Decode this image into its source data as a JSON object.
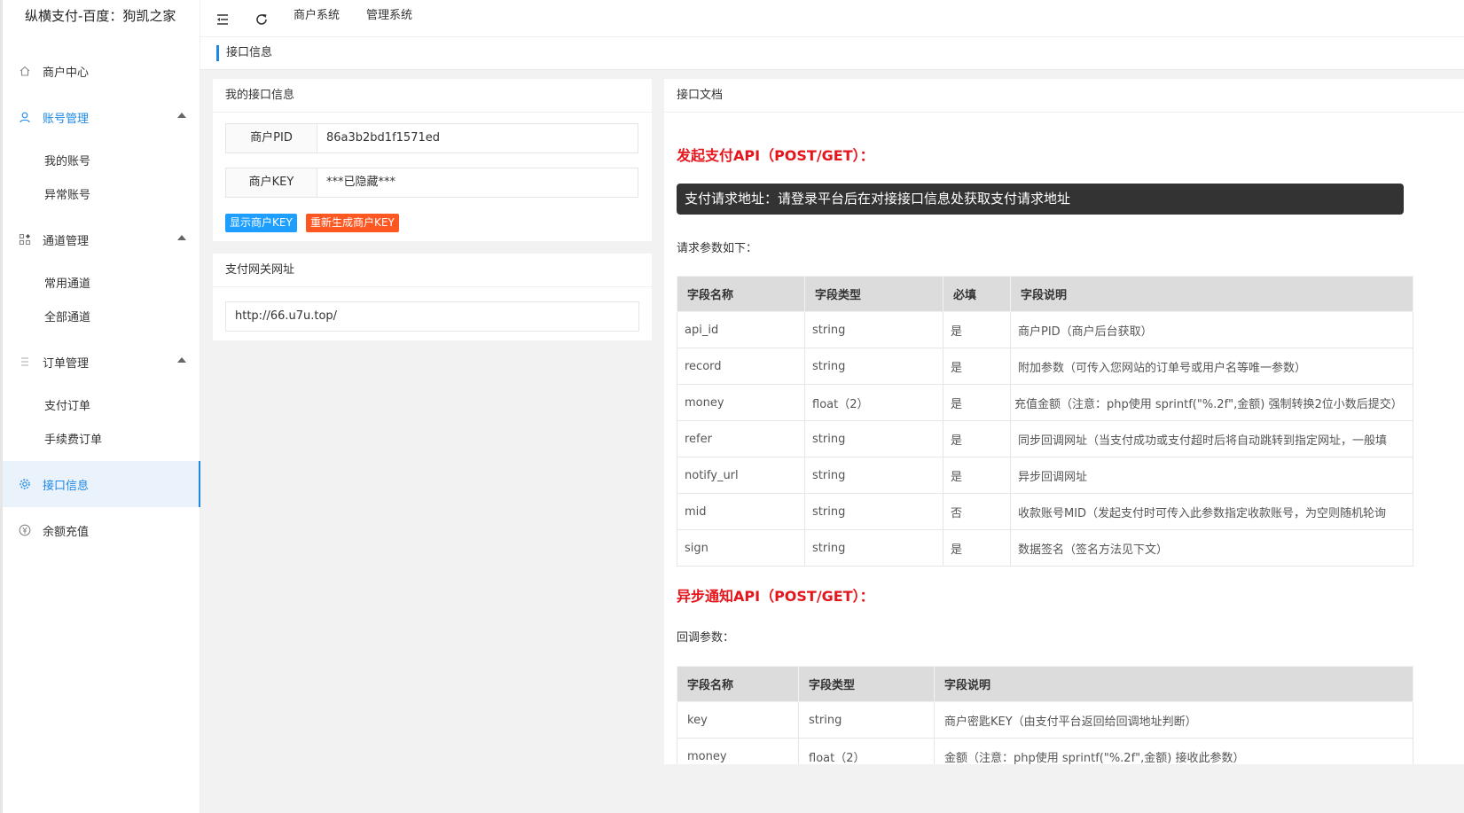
{
  "app": {
    "title": "纵横支付-百度：狗凯之家"
  },
  "topbar": {
    "menu_icon": "menu-fold-icon",
    "refresh_icon": "refresh-icon",
    "links": [
      "商户系统",
      "管理系统"
    ]
  },
  "tabbar": {
    "current": "接口信息"
  },
  "sidebar": {
    "items": [
      {
        "label": "商户中心",
        "icon": "home-icon"
      },
      {
        "label": "账号管理",
        "icon": "user-icon",
        "children": [
          "我的账号",
          "异常账号"
        ]
      },
      {
        "label": "通道管理",
        "icon": "apps-icon",
        "children": [
          "常用通道",
          "全部通道"
        ]
      },
      {
        "label": "订单管理",
        "icon": "list-icon",
        "children": [
          "支付订单",
          "手续费订单"
        ]
      },
      {
        "label": "接口信息",
        "icon": "gear-icon"
      },
      {
        "label": "余额充值",
        "icon": "yen-icon"
      }
    ]
  },
  "my_api": {
    "title": "我的接口信息",
    "pid_label": "商户PID",
    "pid_value": "86a3b2bd1f1571ed",
    "key_label": "商户KEY",
    "key_value": "***已隐藏***",
    "show_key_button": "显示商户KEY",
    "regen_key_button": "重新生成商户KEY"
  },
  "gateway": {
    "title": "支付网关网址",
    "url": "http://66.u7u.top/"
  },
  "doc": {
    "title": "接口文档",
    "pay_title": "发起支付API（POST/GET）：",
    "pay_url_note": "支付请求地址：请登录平台后在对接接口信息处获取支付请求地址",
    "request_params_label": "请求参数如下：",
    "request_table": {
      "headers": [
        "字段名称",
        "字段类型",
        "必填",
        "字段说明"
      ],
      "rows": [
        [
          "api_id",
          "string",
          "是",
          "商户PID（商户后台获取）"
        ],
        [
          "record",
          "string",
          "是",
          "附加参数（可传入您网站的订单号或用户名等唯一参数）"
        ],
        [
          "money",
          "float（2）",
          "是",
          "充值金额（注意：php使用 sprintf(\"%.2f\",金额) 强制转换2位小数后提交）"
        ],
        [
          "refer",
          "string",
          "是",
          "同步回调网址（当支付成功或支付超时后将自动跳转到指定网址，一般填"
        ],
        [
          "notify_url",
          "string",
          "是",
          "异步回调网址"
        ],
        [
          "mid",
          "string",
          "否",
          "收款账号MID（发起支付时可传入此参数指定收款账号，为空则随机轮询"
        ],
        [
          "sign",
          "string",
          "是",
          "数据签名（签名方法见下文）"
        ]
      ]
    },
    "notify_title": "异步通知API（POST/GET）：",
    "callback_params_label": "回调参数：",
    "callback_table": {
      "headers": [
        "字段名称",
        "字段类型",
        "字段说明"
      ],
      "rows": [
        [
          "key",
          "string",
          "商户密匙KEY（由支付平台返回给回调地址判断）"
        ],
        [
          "money",
          "float（2）",
          "金额（注意：php使用 sprintf(\"%.2f\",金额) 接收此参数）"
        ]
      ]
    }
  },
  "colors": {
    "accent": "#1e88e5",
    "danger_title": "#e4161d",
    "show_key_btn": "#1e9fff",
    "regen_key_btn": "#ff5722"
  }
}
